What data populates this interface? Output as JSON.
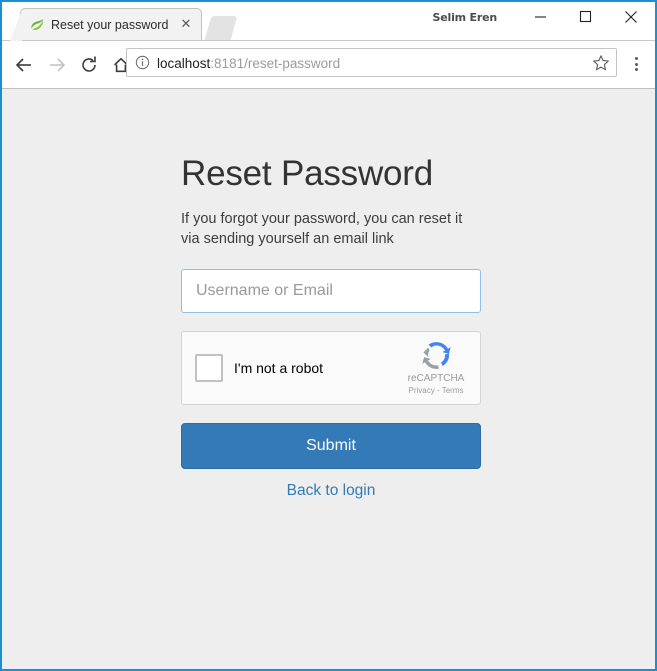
{
  "window": {
    "profile_name": "Selim Eren",
    "accent_color": "#1c8fd0",
    "controls": {
      "minimize": "—",
      "maximize": "☐",
      "close": "✕"
    }
  },
  "tabs": [
    {
      "title": "Reset your password",
      "favicon": "spring-leaf-icon",
      "close_label": "✕"
    }
  ],
  "new_tab": {
    "label": ""
  },
  "toolbar": {
    "back_icon": "arrow-left-icon",
    "forward_icon": "arrow-right-icon",
    "reload_icon": "reload-icon",
    "home_icon": "home-icon",
    "page_info_icon": "info-circle-icon",
    "bookmark_icon": "star-outline-icon",
    "menu_icon": "kebab-menu-icon",
    "url_host": "localhost",
    "url_rest": ":8181/reset-password",
    "url_full": "localhost:8181/reset-password"
  },
  "page": {
    "background": "#eeeeee",
    "heading": "Reset Password",
    "subtitle": "If you forgot your password, you can reset it via sending yourself an email link",
    "form": {
      "username": {
        "value": "",
        "placeholder": "Username or Email"
      },
      "recaptcha": {
        "label": "I'm not a robot",
        "brand": "reCAPTCHA",
        "legal": "Privacy - Terms",
        "logo_icon": "recaptcha-logo-icon",
        "checked": false
      },
      "submit_label": "Submit",
      "submit_color": "#337ab7",
      "back_link_label": "Back to login",
      "link_color": "#337ab7"
    }
  }
}
